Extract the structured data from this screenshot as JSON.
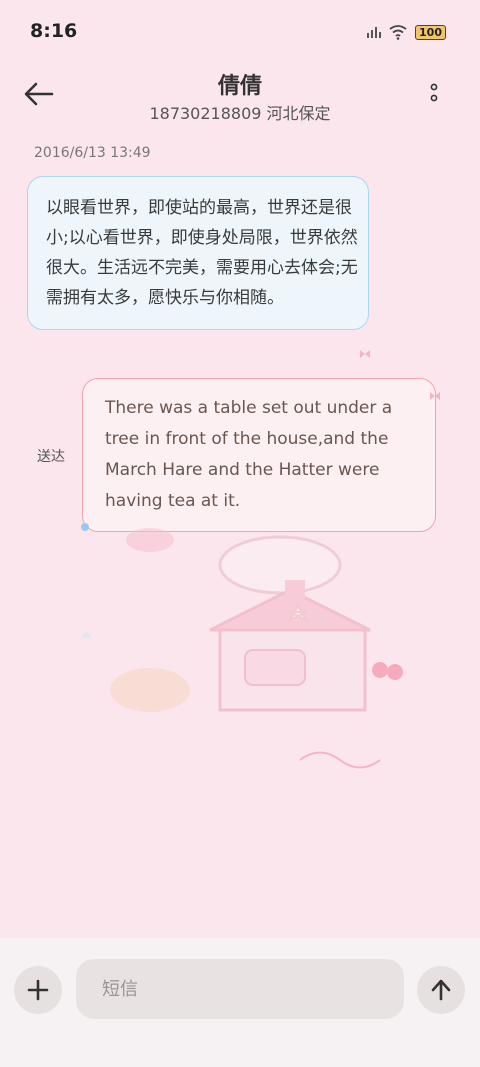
{
  "status_bar": {
    "time": "8:16",
    "battery": "100"
  },
  "header": {
    "contact_name": "倩倩",
    "contact_info": "18730218809 河北保定"
  },
  "conversation": {
    "timestamp": "2016/6/13 13:49",
    "messages": [
      {
        "direction": "incoming",
        "text": "以眼看世界，即使站的最高，世界还是很小;以心看世界，即使身处局限，世界依然很大。生活远不完美，需要用心去体会;无需拥有太多，愿快乐与你相随。"
      },
      {
        "direction": "outgoing",
        "text": "There was a table set out under a tree in front of the house,and the March Hare and the Hatter were having tea at it.",
        "status": "送达"
      }
    ]
  },
  "composer": {
    "placeholder": "短信"
  },
  "colors": {
    "incoming_border": "#a9d6f1",
    "outgoing_border": "#f2a3b2",
    "background": "#fbe6ee"
  }
}
